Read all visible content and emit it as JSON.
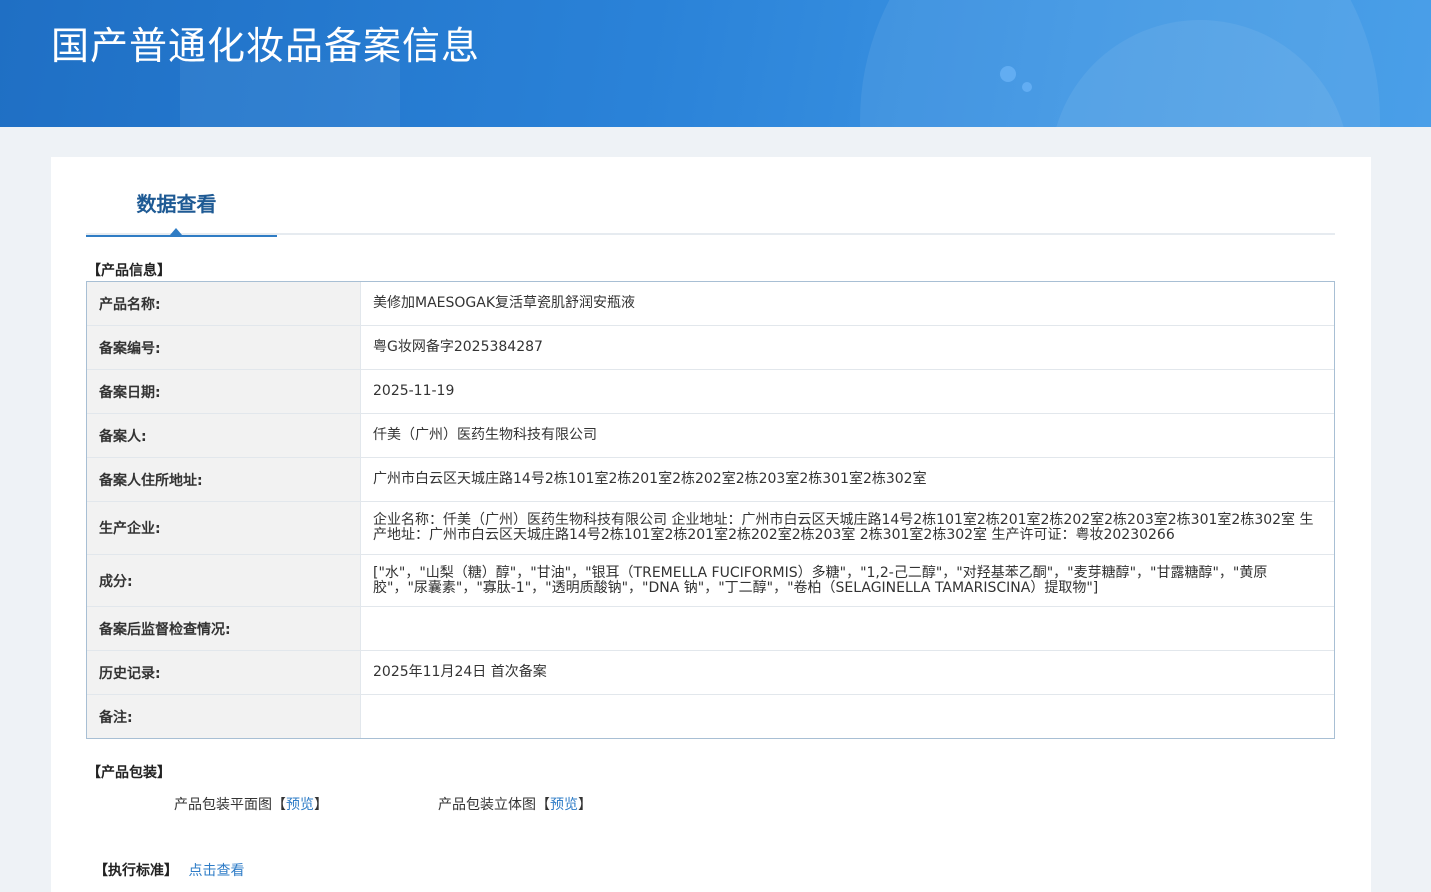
{
  "header": {
    "title": "国产普通化妆品备案信息"
  },
  "tabs": [
    {
      "label": "数据查看",
      "active": true
    }
  ],
  "product_info": {
    "section_title": "【产品信息】",
    "rows": [
      {
        "label": "产品名称:",
        "value": "美修加MAESOGAK复活草瓷肌舒润安瓶液"
      },
      {
        "label": "备案编号:",
        "value": "粤G妆网备字2025384287"
      },
      {
        "label": "备案日期:",
        "value": "2025-11-19"
      },
      {
        "label": "备案人:",
        "value": "仟美（广州）医药生物科技有限公司"
      },
      {
        "label": "备案人住所地址:",
        "value": "广州市白云区天城庄路14号2栋101室2栋201室2栋202室2栋203室2栋301室2栋302室"
      },
      {
        "label": "生产企业:",
        "value": "企业名称：仟美（广州）医药生物科技有限公司 企业地址：广州市白云区天城庄路14号2栋101室2栋201室2栋202室2栋203室2栋301室2栋302室 生产地址：广州市白云区天城庄路14号2栋101室2栋201室2栋202室2栋203室 2栋301室2栋302室 生产许可证：粤妆20230266"
      },
      {
        "label": "成分:",
        "value": "[\"水\"，\"山梨（糖）醇\"，\"甘油\"，\"银耳（TREMELLA FUCIFORMIS）多糖\"，\"1,2-己二醇\"，\"对羟基苯乙酮\"，\"麦芽糖醇\"，\"甘露糖醇\"，\"黄原胶\"，\"尿囊素\"，\"寡肽-1\"，\"透明质酸钠\"，\"DNA 钠\"，\"丁二醇\"，\"卷柏（SELAGINELLA TAMARISCINA）提取物\"]"
      },
      {
        "label": "备案后监督检查情况:",
        "value": ""
      },
      {
        "label": "历史记录:",
        "value": "2025年11月24日 首次备案"
      },
      {
        "label": "备注:",
        "value": ""
      }
    ]
  },
  "packaging": {
    "section_title": "【产品包装】",
    "items": [
      {
        "label": "产品包装平面图",
        "bracket_open": "【",
        "link": "预览",
        "bracket_close": "】"
      },
      {
        "label": "产品包装立体图",
        "bracket_open": "【",
        "link": "预览",
        "bracket_close": "】"
      }
    ]
  },
  "standard": {
    "section_title": "【执行标准】",
    "link": "点击查看"
  },
  "colors": {
    "banner": "#2a82d8",
    "accent": "#2f7cc4",
    "link": "#2e7cc7",
    "table_border": "#a8bfd4",
    "label_bg": "#f2f2f2"
  }
}
